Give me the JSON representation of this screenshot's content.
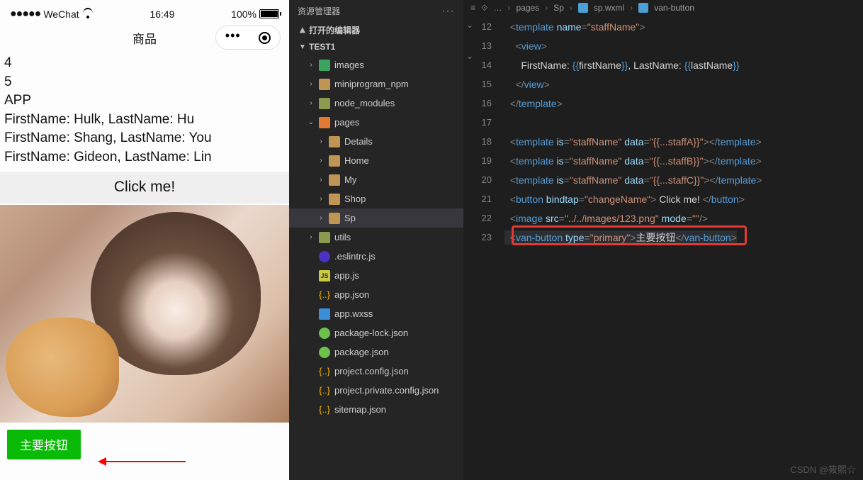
{
  "simulator": {
    "statusbar": {
      "carrier": "WeChat",
      "time": "16:49",
      "battery": "100%",
      "signal_dots": "●●●●●"
    },
    "title": "商品",
    "lines": [
      "4",
      "5",
      "APP",
      "FirstName: Hulk, LastName: Hu",
      "FirstName: Shang, LastName: You",
      "FirstName: Gideon, LastName: Lin"
    ],
    "click_button": "Click me!",
    "primary_button": "主要按钮"
  },
  "explorer": {
    "header": "资源管理器",
    "more": "···",
    "sections": {
      "open_editors": "打开的编辑器",
      "project": "TEST1"
    },
    "tree": [
      {
        "name": "images",
        "depth": 0,
        "icon": "folder green",
        "chev": "›"
      },
      {
        "name": "miniprogram_npm",
        "depth": 0,
        "icon": "folder",
        "chev": "›"
      },
      {
        "name": "node_modules",
        "depth": 0,
        "icon": "folder olive",
        "chev": "›"
      },
      {
        "name": "pages",
        "depth": 0,
        "icon": "folder orange",
        "chev": "⌄"
      },
      {
        "name": "Details",
        "depth": 1,
        "icon": "folder",
        "chev": "›"
      },
      {
        "name": "Home",
        "depth": 1,
        "icon": "folder",
        "chev": "›"
      },
      {
        "name": "My",
        "depth": 1,
        "icon": "folder",
        "chev": "›"
      },
      {
        "name": "Shop",
        "depth": 1,
        "icon": "folder",
        "chev": "›"
      },
      {
        "name": "Sp",
        "depth": 1,
        "icon": "folder",
        "chev": "›",
        "active": true
      },
      {
        "name": "utils",
        "depth": 0,
        "icon": "folder olive",
        "chev": "›"
      },
      {
        "name": ".eslintrc.js",
        "depth": 0,
        "icon": "eslint",
        "chev": ""
      },
      {
        "name": "app.js",
        "depth": 0,
        "icon": "js",
        "chev": ""
      },
      {
        "name": "app.json",
        "depth": 0,
        "icon": "json",
        "chev": ""
      },
      {
        "name": "app.wxss",
        "depth": 0,
        "icon": "wxss",
        "chev": ""
      },
      {
        "name": "package-lock.json",
        "depth": 0,
        "icon": "node",
        "chev": ""
      },
      {
        "name": "package.json",
        "depth": 0,
        "icon": "node",
        "chev": ""
      },
      {
        "name": "project.config.json",
        "depth": 0,
        "icon": "json",
        "chev": ""
      },
      {
        "name": "project.private.config.json",
        "depth": 0,
        "icon": "json",
        "chev": ""
      },
      {
        "name": "sitemap.json",
        "depth": 0,
        "icon": "json",
        "chev": ""
      }
    ]
  },
  "editor": {
    "breadcrumbs": [
      "pages",
      "Sp",
      "sp.wxml",
      "van-button"
    ],
    "lines": [
      {
        "n": 12,
        "tokens": [
          [
            "t-tag",
            "<"
          ],
          [
            "t-el",
            "template"
          ],
          [
            "t-ws",
            " "
          ],
          [
            "t-attr",
            "name"
          ],
          [
            "t-tag",
            "="
          ],
          [
            "t-str",
            "\"staffName\""
          ],
          [
            "t-tag",
            ">"
          ]
        ],
        "indent": 1
      },
      {
        "n": 13,
        "tokens": [
          [
            "t-tag",
            "<"
          ],
          [
            "t-el",
            "view"
          ],
          [
            "t-tag",
            ">"
          ]
        ],
        "indent": 2
      },
      {
        "n": 14,
        "tokens": [
          [
            "t-ws",
            "FirstName: "
          ],
          [
            "t-br",
            "{{"
          ],
          [
            "t-ws",
            "firstName"
          ],
          [
            "t-br",
            "}}"
          ],
          [
            "t-ws",
            ", LastName: "
          ],
          [
            "t-br",
            "{{"
          ],
          [
            "t-ws",
            "lastName"
          ],
          [
            "t-br",
            "}}"
          ]
        ],
        "indent": 3
      },
      {
        "n": 15,
        "tokens": [
          [
            "t-tag",
            "</"
          ],
          [
            "t-el",
            "view"
          ],
          [
            "t-tag",
            ">"
          ]
        ],
        "indent": 2
      },
      {
        "n": 16,
        "tokens": [
          [
            "t-tag",
            "</"
          ],
          [
            "t-el",
            "template"
          ],
          [
            "t-tag",
            ">"
          ]
        ],
        "indent": 1
      },
      {
        "n": 17,
        "tokens": [],
        "indent": 1
      },
      {
        "n": 18,
        "tokens": [
          [
            "t-tag",
            "<"
          ],
          [
            "t-el",
            "template"
          ],
          [
            "t-ws",
            " "
          ],
          [
            "t-attr",
            "is"
          ],
          [
            "t-tag",
            "="
          ],
          [
            "t-str",
            "\"staffName\""
          ],
          [
            "t-ws",
            " "
          ],
          [
            "t-attr",
            "data"
          ],
          [
            "t-tag",
            "="
          ],
          [
            "t-str",
            "\"{{...staffA}}\""
          ],
          [
            "t-tag",
            "></"
          ],
          [
            "t-el",
            "template"
          ],
          [
            "t-tag",
            ">"
          ]
        ],
        "indent": 1
      },
      {
        "n": 19,
        "tokens": [
          [
            "t-tag",
            "<"
          ],
          [
            "t-el",
            "template"
          ],
          [
            "t-ws",
            " "
          ],
          [
            "t-attr",
            "is"
          ],
          [
            "t-tag",
            "="
          ],
          [
            "t-str",
            "\"staffName\""
          ],
          [
            "t-ws",
            " "
          ],
          [
            "t-attr",
            "data"
          ],
          [
            "t-tag",
            "="
          ],
          [
            "t-str",
            "\"{{...staffB}}\""
          ],
          [
            "t-tag",
            "></"
          ],
          [
            "t-el",
            "template"
          ],
          [
            "t-tag",
            ">"
          ]
        ],
        "indent": 1
      },
      {
        "n": 20,
        "tokens": [
          [
            "t-tag",
            "<"
          ],
          [
            "t-el",
            "template"
          ],
          [
            "t-ws",
            " "
          ],
          [
            "t-attr",
            "is"
          ],
          [
            "t-tag",
            "="
          ],
          [
            "t-str",
            "\"staffName\""
          ],
          [
            "t-ws",
            " "
          ],
          [
            "t-attr",
            "data"
          ],
          [
            "t-tag",
            "="
          ],
          [
            "t-str",
            "\"{{...staffC}}\""
          ],
          [
            "t-tag",
            "></"
          ],
          [
            "t-el",
            "template"
          ],
          [
            "t-tag",
            ">"
          ]
        ],
        "indent": 1
      },
      {
        "n": 21,
        "tokens": [
          [
            "t-tag",
            "<"
          ],
          [
            "t-el",
            "button"
          ],
          [
            "t-ws",
            " "
          ],
          [
            "t-attr",
            "bindtap"
          ],
          [
            "t-tag",
            "="
          ],
          [
            "t-str",
            "\"changeName\""
          ],
          [
            "t-tag",
            ">"
          ],
          [
            "t-ws",
            " Click me! "
          ],
          [
            "t-tag",
            "</"
          ],
          [
            "t-el",
            "button"
          ],
          [
            "t-tag",
            ">"
          ]
        ],
        "indent": 1
      },
      {
        "n": 22,
        "tokens": [
          [
            "t-tag",
            "<"
          ],
          [
            "t-el",
            "image"
          ],
          [
            "t-ws",
            " "
          ],
          [
            "t-attr",
            "src"
          ],
          [
            "t-tag",
            "="
          ],
          [
            "t-str",
            "\"../../images/123.png\""
          ],
          [
            "t-ws",
            " "
          ],
          [
            "t-attr",
            "mode"
          ],
          [
            "t-tag",
            "="
          ],
          [
            "t-str",
            "\"\""
          ],
          [
            "t-tag",
            "/>"
          ]
        ],
        "indent": 1
      },
      {
        "n": 23,
        "tokens": [
          [
            "t-tag",
            "<"
          ],
          [
            "t-el",
            "van-button"
          ],
          [
            "t-ws",
            " "
          ],
          [
            "t-attr",
            "type"
          ],
          [
            "t-tag",
            "="
          ],
          [
            "t-str",
            "\"primary\""
          ],
          [
            "t-tag",
            ">"
          ],
          [
            "t-ws",
            "主要按钮"
          ],
          [
            "t-tag",
            "</"
          ],
          [
            "t-el",
            "van-button"
          ],
          [
            "t-tag",
            ">"
          ]
        ],
        "indent": 1,
        "hilite": true
      }
    ]
  },
  "watermark": "CSDN @筱熙☆"
}
